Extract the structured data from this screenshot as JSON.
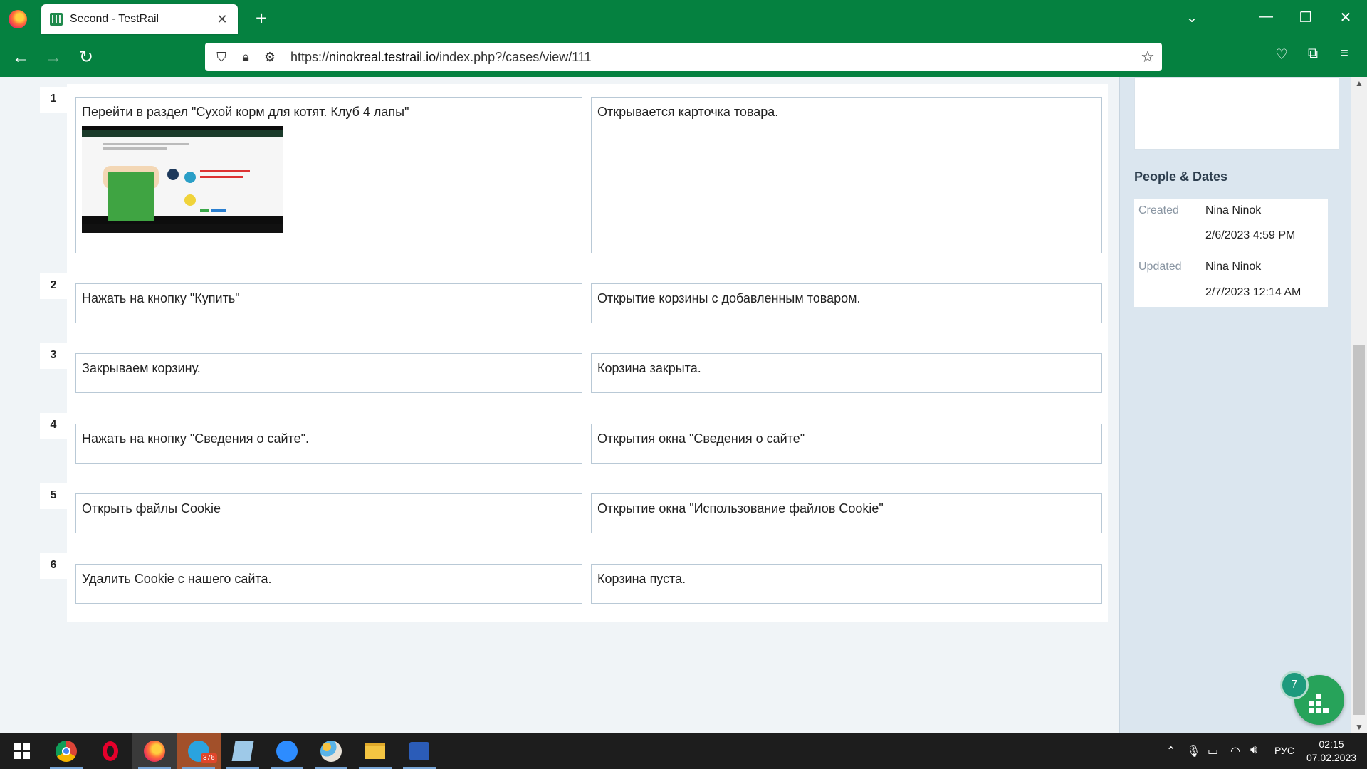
{
  "browser": {
    "tab_title": "Second - TestRail",
    "tab_close": "✕",
    "new_tab": "+",
    "url_prefix": "https://",
    "url_domain": "ninokreal.testrail.io",
    "url_path": "/index.php?/cases/view/111"
  },
  "steps": [
    {
      "num": "1",
      "action": "Перейти в раздел \"Сухой корм для котят. Клуб 4 лапы\"",
      "expected": "Открывается карточка товара."
    },
    {
      "num": "2",
      "action": "Нажать на кнопку \"Купить\"",
      "expected": "Открытие корзины с добавленным товаром."
    },
    {
      "num": "3",
      "action": "Закрываем корзину.",
      "expected": "Корзина закрыта."
    },
    {
      "num": "4",
      "action": "Нажать на кнопку \"Сведения о сайте\".",
      "expected": "Открытия окна \"Сведения о сайте\""
    },
    {
      "num": "5",
      "action": "Открыть файлы Cookie",
      "expected": "Открытие окна \"Использование файлов Cookie\""
    },
    {
      "num": "6",
      "action": "Удалить Cookie с нашего сайта.",
      "expected": "Корзина пуста."
    }
  ],
  "sidebar": {
    "heading": "People & Dates",
    "created_label": "Created",
    "created_by": "Nina Ninok",
    "created_at": "2/6/2023 4:59 PM",
    "updated_label": "Updated",
    "updated_by": "Nina Ninok",
    "updated_at": "2/7/2023 12:14 AM"
  },
  "widget": {
    "badge_count": "7"
  },
  "taskbar": {
    "telegram_badge": "376",
    "language": "РУС",
    "time": "02:15",
    "date": "07.02.2023"
  }
}
